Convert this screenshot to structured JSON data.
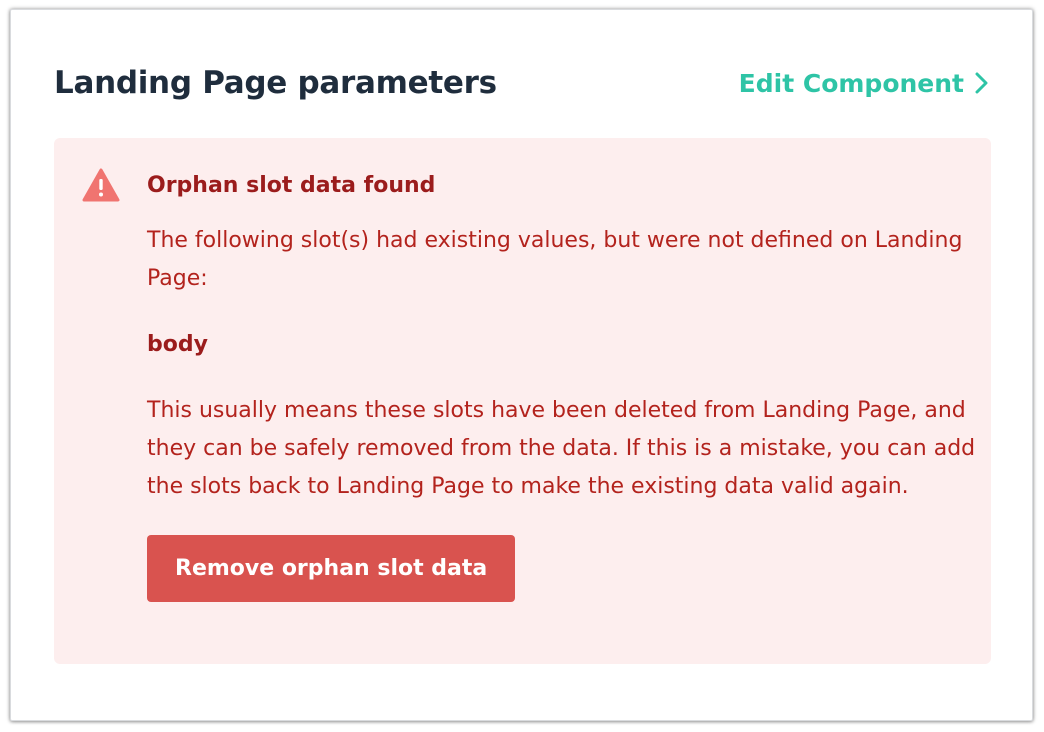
{
  "header": {
    "title": "Landing Page parameters",
    "edit_link": "Edit Component"
  },
  "alert": {
    "heading": "Orphan slot data found",
    "intro": "The following slot(s) had existing values, but were not defined on Landing Page:",
    "slots": [
      "body"
    ],
    "explanation": "This usually means these slots have been deleted from Landing Page, and they can be safely removed from the data. If this is a mistake, you can add the slots back to Landing Page to make the existing data valid again.",
    "button_label": "Remove orphan slot data"
  },
  "icons": {
    "warning": "warning-triangle-icon",
    "chevron": "chevron-right-icon"
  },
  "colors": {
    "accent": "#2ec4a6",
    "title": "#1f2d3d",
    "alert_bg": "#fdeeee",
    "alert_text": "#b3231d",
    "button_bg": "#d9534f"
  }
}
